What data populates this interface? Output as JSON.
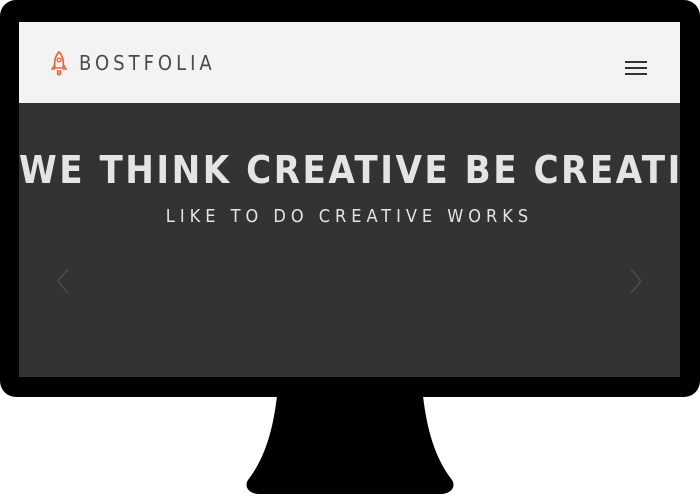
{
  "header": {
    "brand": "BOSTFOLIA",
    "logo_icon": "rocket-icon",
    "menu_icon": "hamburger-menu-icon"
  },
  "hero": {
    "title": "WE THINK CREATIVE BE CREATIVE",
    "subtitle": "LIKE TO DO CREATIVE WORKS",
    "prev_icon": "chevron-left-icon",
    "next_icon": "chevron-right-icon"
  },
  "colors": {
    "bezel": "#000000",
    "header_bg": "#f4f2f3",
    "hero_bg": "#333333",
    "accent": "#e8623a",
    "hero_text": "#e4e4e4",
    "brand_text": "#4a4a4a"
  }
}
